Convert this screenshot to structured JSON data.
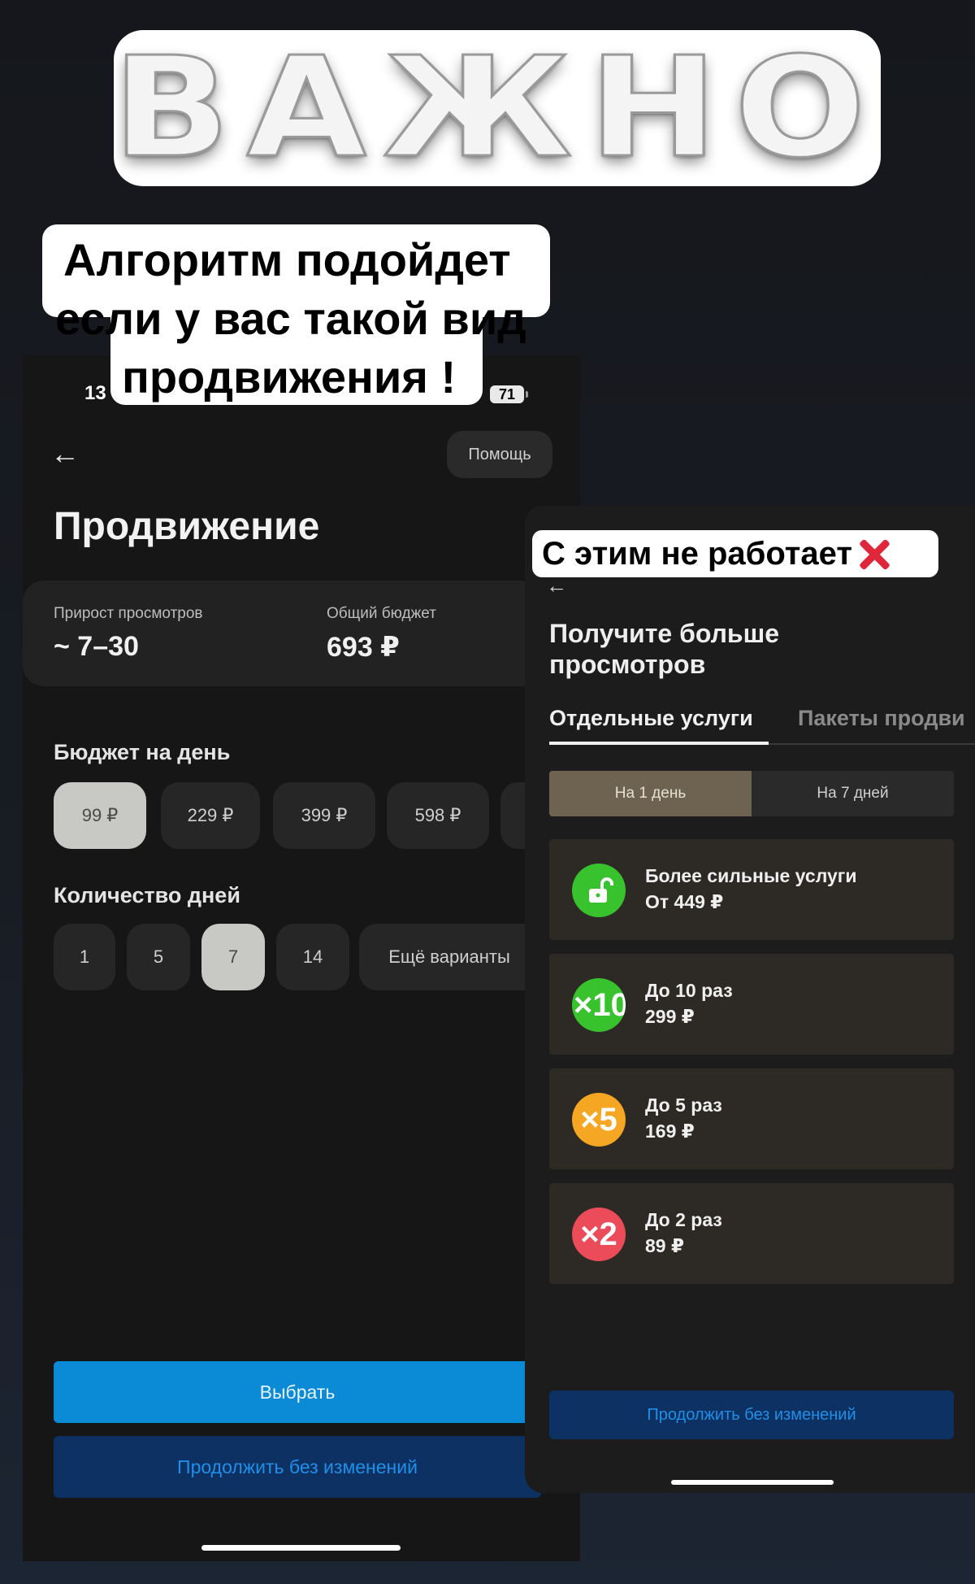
{
  "banner": {
    "text": "ВАЖНО"
  },
  "caption_top": {
    "lines": [
      "Алгоритм подойдет",
      "если у вас такой вид",
      "продвижения !"
    ]
  },
  "left_screen": {
    "status": {
      "time": "13",
      "battery": "71"
    },
    "help_label": "Помощь",
    "title": "Продвижение",
    "stats": {
      "views_label": "Прирост просмотров",
      "views_value": "~ 7–30",
      "budget_label": "Общий бюджет",
      "budget_value": "693 ₽"
    },
    "daily_budget": {
      "label": "Бюджет на день",
      "options": [
        "99 ₽",
        "229 ₽",
        "399 ₽",
        "598 ₽"
      ],
      "selected": "99 ₽"
    },
    "days": {
      "label": "Количество дней",
      "options": [
        "1",
        "5",
        "7",
        "14",
        "Ещё варианты"
      ],
      "selected": "7"
    },
    "select_button": "Выбрать",
    "continue_button": "Продолжить без изменений"
  },
  "caption_right": {
    "text": "С этим не работает",
    "icon": "cross-mark-icon",
    "icon_color": "#e0263a"
  },
  "right_screen": {
    "title": "Получите больше просмотров",
    "tabs": [
      "Отдельные услуги",
      "Пакеты продви"
    ],
    "segments": [
      "На 1 день",
      "На 7 дней"
    ],
    "services": [
      {
        "icon": "unlock-icon",
        "icon_text": "",
        "color": "#37c22e",
        "title": "Более сильные услуги",
        "price": "От 449 ₽"
      },
      {
        "icon": "x10-icon",
        "icon_text": "×10",
        "color": "#37c22e",
        "title": "До 10 раз",
        "price": "299 ₽"
      },
      {
        "icon": "x5-icon",
        "icon_text": "×5",
        "color": "#f5a623",
        "title": "До 5 раз",
        "price": "169 ₽"
      },
      {
        "icon": "x2-icon",
        "icon_text": "×2",
        "color": "#ec4b5a",
        "title": "До 2 раз",
        "price": "89 ₽"
      }
    ],
    "continue_button": "Продолжить без изменений"
  }
}
